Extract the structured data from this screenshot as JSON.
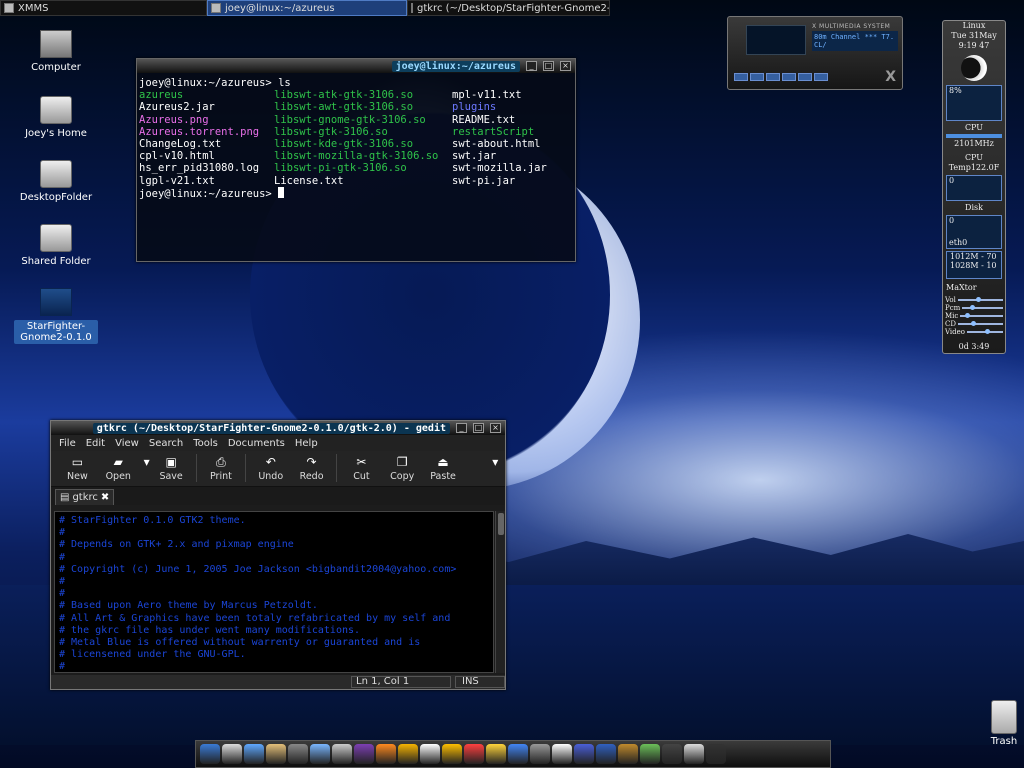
{
  "taskbar": {
    "tasks": [
      {
        "label": "XMMS"
      },
      {
        "label": "joey@linux:~/azureus"
      },
      {
        "label": "gtkrc (~/Desktop/StarFighter-Gnome2-..."
      }
    ]
  },
  "desktop_icons": [
    {
      "label": "Computer"
    },
    {
      "label": "Joey's Home"
    },
    {
      "label": "DesktopFolder"
    },
    {
      "label": "Shared Folder"
    },
    {
      "label": "StarFighter-Gnome2-0.1.0"
    }
  ],
  "terminal": {
    "title": "joey@linux:~/azureus",
    "prompt_line": "joey@linux:~/azureus> ls",
    "rows": [
      [
        {
          "t": "azureus",
          "c": "g"
        },
        {
          "t": "libswt-atk-gtk-3106.so",
          "c": "g"
        },
        {
          "t": "mpl-v11.txt",
          "c": "w"
        }
      ],
      [
        {
          "t": "Azureus2.jar",
          "c": "w"
        },
        {
          "t": "libswt-awt-gtk-3106.so",
          "c": "g"
        },
        {
          "t": "plugins",
          "c": "b"
        }
      ],
      [
        {
          "t": "Azureus.png",
          "c": "m"
        },
        {
          "t": "libswt-gnome-gtk-3106.so",
          "c": "g"
        },
        {
          "t": "README.txt",
          "c": "w"
        }
      ],
      [
        {
          "t": "Azureus.torrent.png",
          "c": "m"
        },
        {
          "t": "libswt-gtk-3106.so",
          "c": "g"
        },
        {
          "t": "restartScript",
          "c": "g"
        }
      ],
      [
        {
          "t": "ChangeLog.txt",
          "c": "w"
        },
        {
          "t": "libswt-kde-gtk-3106.so",
          "c": "g"
        },
        {
          "t": "swt-about.html",
          "c": "w"
        }
      ],
      [
        {
          "t": "cpl-v10.html",
          "c": "w"
        },
        {
          "t": "libswt-mozilla-gtk-3106.so",
          "c": "g"
        },
        {
          "t": "swt.jar",
          "c": "w"
        }
      ],
      [
        {
          "t": "hs_err_pid31080.log",
          "c": "w"
        },
        {
          "t": "libswt-pi-gtk-3106.so",
          "c": "g"
        },
        {
          "t": "swt-mozilla.jar",
          "c": "w"
        }
      ],
      [
        {
          "t": "lgpl-v21.txt",
          "c": "w"
        },
        {
          "t": "License.txt",
          "c": "w"
        },
        {
          "t": "swt-pi.jar",
          "c": "w"
        }
      ]
    ],
    "last_prompt": "joey@linux:~/azureus> "
  },
  "gedit": {
    "title": "gtkrc (~/Desktop/StarFighter-Gnome2-0.1.0/gtk-2.0) - gedit",
    "menu": [
      "File",
      "Edit",
      "View",
      "Search",
      "Tools",
      "Documents",
      "Help"
    ],
    "toolbar": [
      {
        "label": "New",
        "icon": "new-doc-icon"
      },
      {
        "label": "Open",
        "icon": "open-folder-icon"
      },
      {
        "label": "Save",
        "icon": "save-icon"
      },
      {
        "label": "Print",
        "icon": "print-icon"
      },
      {
        "label": "Undo",
        "icon": "undo-icon"
      },
      {
        "label": "Redo",
        "icon": "redo-icon"
      },
      {
        "label": "Cut",
        "icon": "cut-icon"
      },
      {
        "label": "Copy",
        "icon": "copy-icon"
      },
      {
        "label": "Paste",
        "icon": "paste-icon"
      }
    ],
    "tab": "gtkrc",
    "lines": [
      "# StarFighter 0.1.0 GTK2 theme.",
      "#",
      "# Depends on GTK+ 2.x and pixmap engine",
      "#",
      "# Copyright (c) June 1, 2005 Joe Jackson <bigbandit2004@yahoo.com>",
      "#",
      "#",
      "# Based upon Aero theme by Marcus Petzoldt.",
      "# All Art & Graphics have been totaly refabricated by my self and",
      "# the gkrc file has under went many modifications.",
      "# Metal Blue is offered without warrenty or guaranted and is",
      "# licensened under the GNU-GPL.",
      "#"
    ],
    "status_pos": "Ln 1, Col 1",
    "status_mode": "INS"
  },
  "xmms": {
    "label": "X MULTIMEDIA SYSTEM",
    "info": "80m Channel  ***  T7. CL/"
  },
  "gkrellm": {
    "host": "Linux",
    "date": "Tue 31May",
    "time": "9:19 47",
    "cpu_pct": "8%",
    "cpu_label": "CPU",
    "freq": "2101MHz",
    "temp": "CPU Temp122.0F",
    "disk_val": "0",
    "disk_label": "Disk",
    "net_val": "0",
    "net_label": "eth0",
    "mem1": "1012M - 70",
    "mem2": "1028M - 10",
    "drive": "MaXtor",
    "mixer": [
      "Vol",
      "Pcm",
      "Mic",
      "CD",
      "Video"
    ],
    "uptime": "0d  3:49"
  },
  "trash": {
    "label": "Trash"
  },
  "dock_colors": [
    "#3a7bd5",
    "#ddd",
    "#5fa8ff",
    "#e4c07a",
    "#888",
    "#7ab6ff",
    "#ccc",
    "#7d3fb3",
    "#ff8a1f",
    "#f5b301",
    "#fff",
    "#ffbf00",
    "#ff4040",
    "#ffd43b",
    "#4285f4",
    "#999",
    "#ffffff",
    "#4a5fd8",
    "#3060c0",
    "#c08a2d",
    "#6bbf59",
    "#444",
    "#ddd",
    "#333"
  ]
}
